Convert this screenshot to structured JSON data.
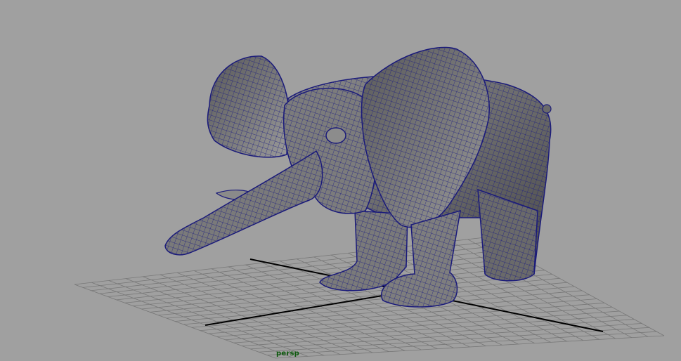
{
  "viewport": {
    "camera_name": "persp",
    "background_color": "#a0a0a0",
    "grid_color": "#777777",
    "axis_color": "#000000",
    "wireframe_color": "#1a1a7a",
    "model_shading_color": "#6e6e6e"
  }
}
